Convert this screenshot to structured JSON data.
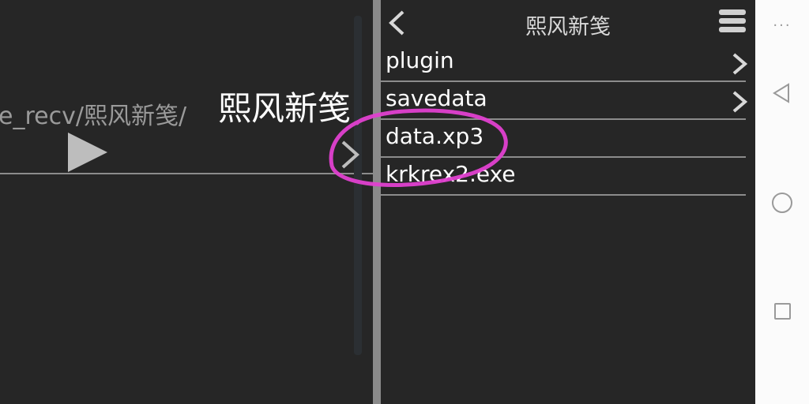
{
  "left_pane": {
    "path_prefix": "e_recv/熙风新笺/",
    "path_current": "熙风新笺"
  },
  "right_pane": {
    "header_title": "熙风新笺",
    "items": [
      {
        "label": "plugin",
        "has_chevron": true
      },
      {
        "label": "savedata",
        "has_chevron": true
      },
      {
        "label": "data.xp3",
        "has_chevron": false
      },
      {
        "label": "krkrex2.exe",
        "has_chevron": false
      }
    ]
  },
  "system_bar": {
    "dots": "···"
  },
  "colors": {
    "background": "#262626",
    "divider": "#8a8a8a",
    "annotation": "#e040d0",
    "system_bar": "#fbfbfb"
  }
}
